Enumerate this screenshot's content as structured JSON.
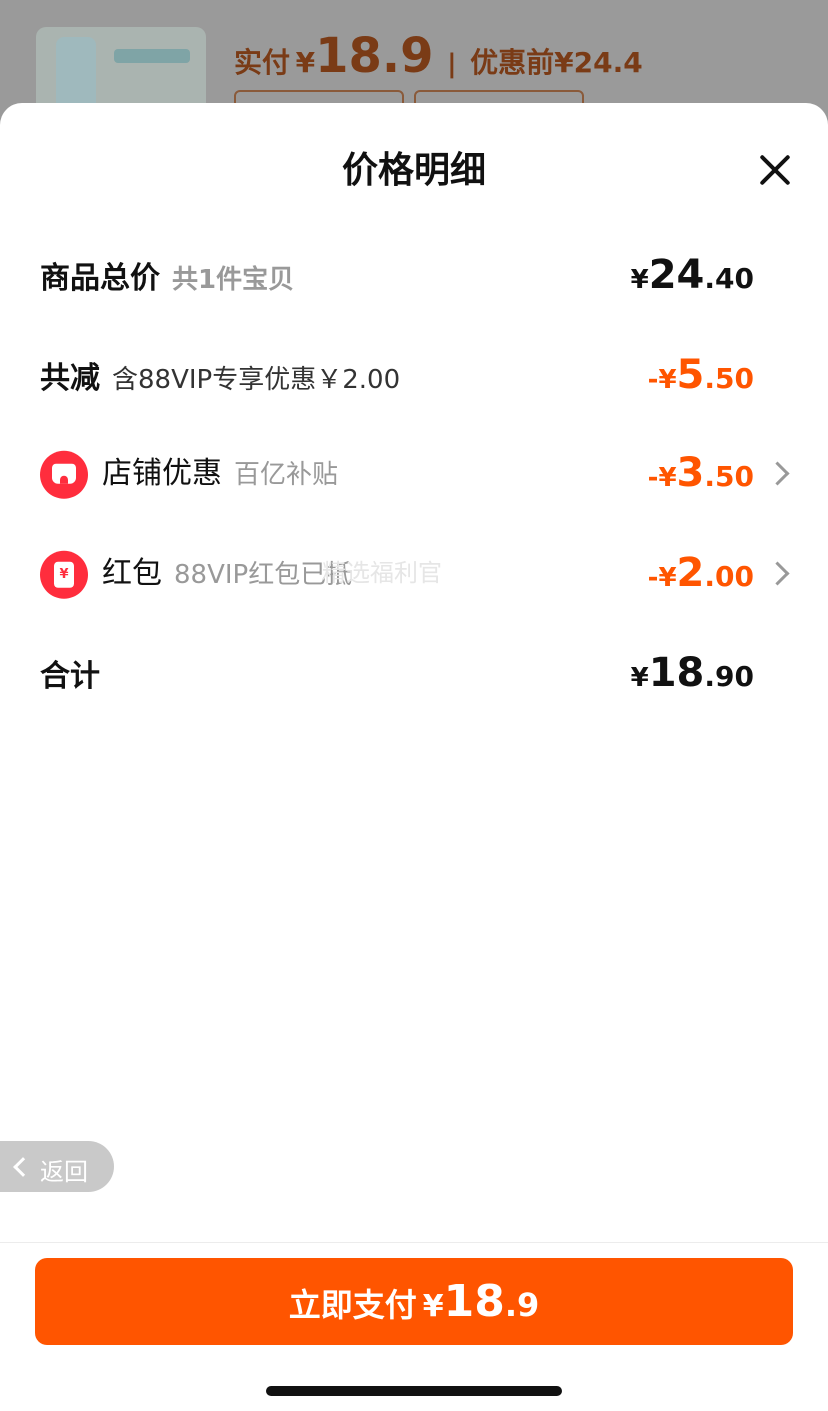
{
  "background": {
    "price_label": "实付",
    "currency": "¥",
    "price_amount": "18.9",
    "separator": "|",
    "original_label": "优惠前¥24.4"
  },
  "sheet": {
    "title": "价格明细",
    "rows": {
      "total": {
        "label": "商品总价",
        "sub": "共1件宝贝",
        "currency": "¥",
        "int": "24",
        "dec": ".40"
      },
      "reduce": {
        "label": "共减",
        "sub": "含88VIP专享优惠￥2.00",
        "currency": "-¥",
        "int": "5",
        "dec": ".50"
      },
      "shop": {
        "label": "店铺优惠",
        "sub": "百亿补贴",
        "currency": "-¥",
        "int": "3",
        "dec": ".50",
        "icon": "shop-icon"
      },
      "redpacket": {
        "label": "红包",
        "sub": "88VIP红包已抵",
        "currency": "-¥",
        "int": "2",
        "dec": ".00",
        "icon": "red-packet-icon",
        "icon_glyph": "¥"
      },
      "sum": {
        "label": "合计",
        "currency": "¥",
        "int": "18",
        "dec": ".90"
      }
    },
    "watermark": "精选福利官"
  },
  "back_button": {
    "label": "返回"
  },
  "pay_button": {
    "label": "立即支付",
    "currency": "¥",
    "int": "18",
    "dec": ".9"
  },
  "colors": {
    "accent": "#ff5500",
    "icon_red": "#ff2d3d"
  }
}
